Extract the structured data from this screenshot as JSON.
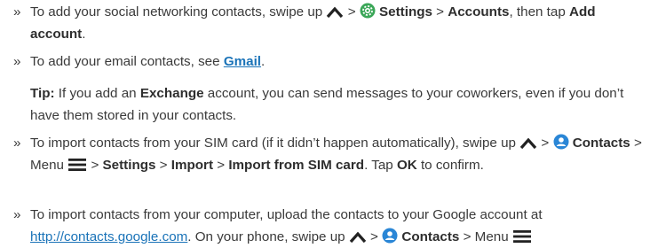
{
  "bullet_symbol": "»",
  "items": [
    {
      "t1": "To add your social networking contacts, swipe up",
      "sep1": " > ",
      "settings": "Settings",
      "sep2": " > ",
      "accounts": "Accounts",
      "t2": ", then tap ",
      "add_account": "Add account",
      "t3": "."
    },
    {
      "t1": "To add your email contacts, see ",
      "gmail": "Gmail",
      "t2": "."
    },
    {
      "tip_label": "Tip:",
      "t1": " If you add an ",
      "exchange": "Exchange",
      "t2": " account, you can send messages to your coworkers, even if you don’t have them stored in your contacts."
    },
    {
      "t1": "To import contacts from your SIM card (if it didn’t happen automatically), swipe up ",
      "sep1": " > ",
      "contacts": "Contacts",
      "sep2": " > Menu ",
      "sep3": " > ",
      "settings": "Settings",
      "sep4": " > ",
      "import": "Import",
      "sep5": " > ",
      "import_sim": "Import from SIM card",
      "t2": ". Tap ",
      "ok": "OK",
      "t3": " to confirm."
    },
    {
      "t1": "To import contacts from your computer, upload the contacts to your Google account at ",
      "url": "http://contacts.google.com",
      "t2": ". On your phone, swipe up ",
      "sep1": " > ",
      "contacts": "Contacts",
      "sep2": " > Menu "
    }
  ],
  "icons": {
    "up": "chevron-up-icon",
    "settings": "settings-gear-icon",
    "contacts": "contacts-person-icon",
    "menu": "menu-hamburger-icon"
  },
  "colors": {
    "text": "#3a3a3a",
    "link": "#1a73b8",
    "settings_icon": "#3aa657",
    "contacts_icon": "#2a86d6"
  }
}
